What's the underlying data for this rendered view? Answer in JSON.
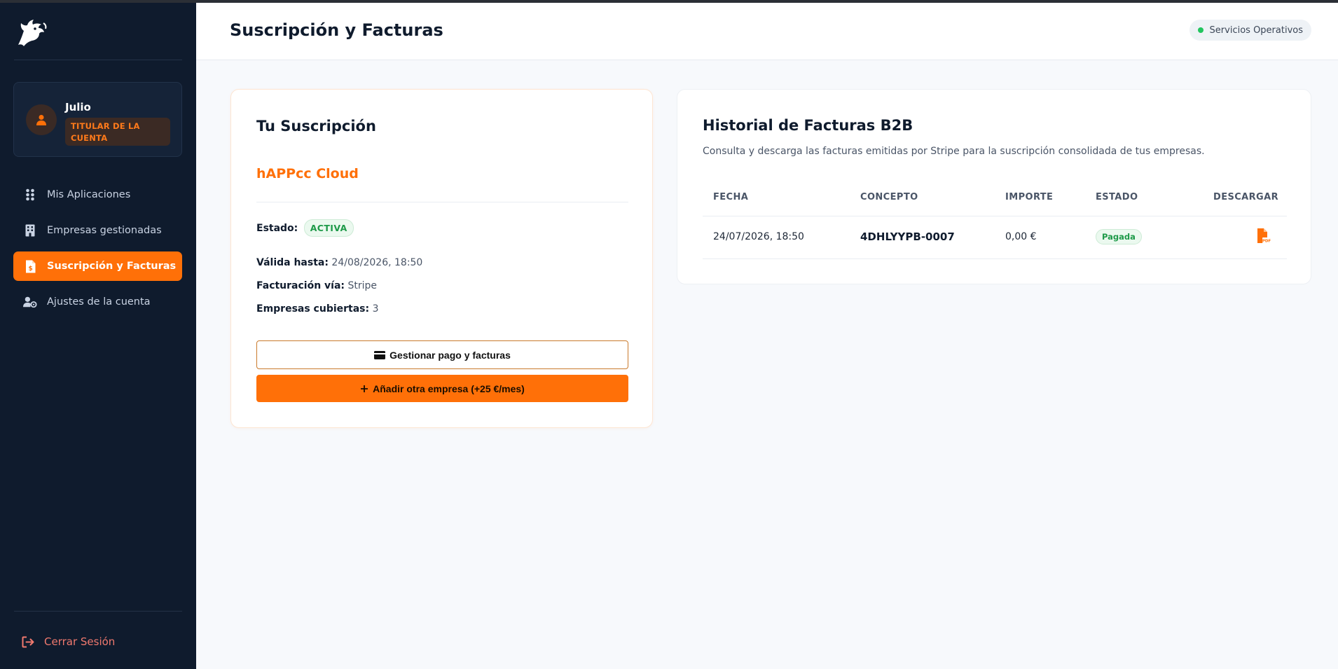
{
  "sidebar": {
    "user": {
      "name": "Julio",
      "role": "TITULAR DE LA CUENTA"
    },
    "nav": [
      {
        "label": "Mis Aplicaciones",
        "icon": "grid-dots-icon"
      },
      {
        "label": "Empresas gestionadas",
        "icon": "building-icon"
      },
      {
        "label": "Suscripción y Facturas",
        "icon": "invoice-dollar-icon",
        "active": true
      },
      {
        "label": "Ajustes de la cuenta",
        "icon": "user-gear-icon"
      }
    ],
    "logout_label": "Cerrar Sesión"
  },
  "header": {
    "title": "Suscripción y Facturas",
    "status": "Servicios Operativos"
  },
  "subscription": {
    "title": "Tu Suscripción",
    "plan": "hAPPcc Cloud",
    "status_label": "Estado:",
    "status_value": "ACTIVA",
    "valid_label": "Válida hasta:",
    "valid_value": "24/08/2026, 18:50",
    "billing_label": "Facturación vía:",
    "billing_value": "Stripe",
    "companies_label": "Empresas cubiertas:",
    "companies_value": "3",
    "manage_button": "Gestionar pago y facturas",
    "add_button": "Añadir otra empresa (+25 €/mes)"
  },
  "invoices": {
    "title": "Historial de Facturas B2B",
    "description": "Consulta y descarga las facturas emitidas por Stripe para la suscripción consolidada de tus empresas.",
    "columns": [
      "FECHA",
      "CONCEPTO",
      "IMPORTE",
      "ESTADO",
      "DESCARGAR"
    ],
    "rows": [
      {
        "date": "24/07/2026, 18:50",
        "concept": "4DHLYYPB-0007",
        "amount": "0,00 €",
        "status": "Pagada"
      }
    ]
  },
  "colors": {
    "accent": "#ff7008",
    "sidebar_bg": "#0f1b2d",
    "success": "#1e9a49",
    "logout": "#f0796e"
  }
}
